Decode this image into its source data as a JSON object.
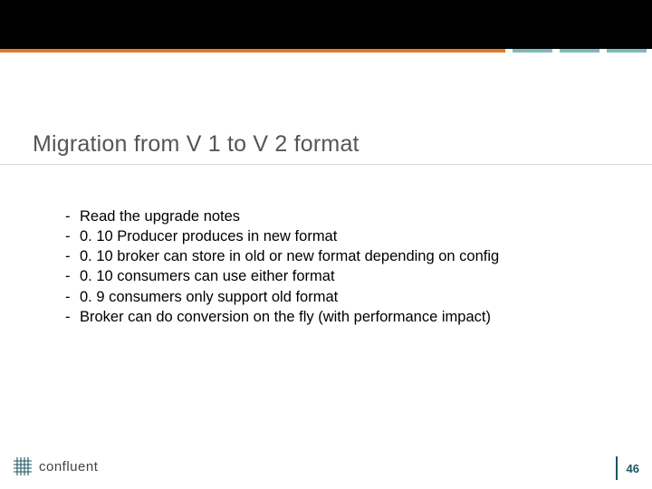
{
  "title": "Migration from V 1 to V 2 format",
  "bullets": [
    "Read the upgrade notes",
    "0. 10 Producer produces in new format",
    "0. 10 broker can store in old or new format depending on config",
    "0. 10 consumers can use either format",
    "0. 9 consumers only support old format",
    "Broker can do conversion on the fly (with performance impact)"
  ],
  "logo_text": "confluent",
  "page_number": "46"
}
